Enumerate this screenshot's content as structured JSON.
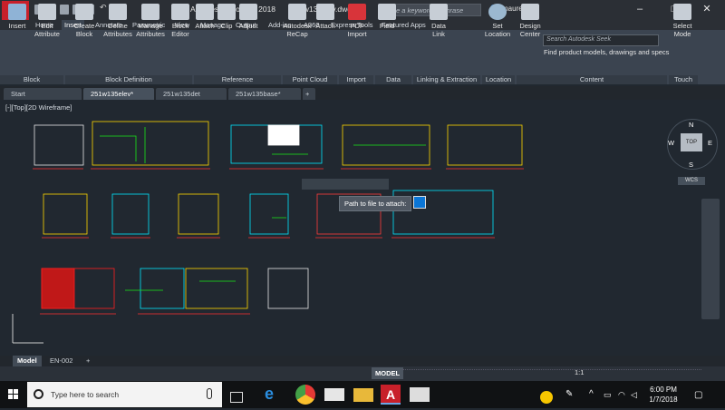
{
  "app": {
    "logo": "A",
    "title": "Autodesk AutoCAD 2018",
    "filename": "251w135elev.dwg",
    "search_placeholder": "Type a keyword or phrase",
    "user": "maureenc",
    "win_min": "–",
    "win_max": "□",
    "win_close": "✕"
  },
  "ribbon_tabs": [
    "Home",
    "Insert",
    "Annotate",
    "Parametric",
    "View",
    "Manage",
    "Output",
    "Add-ins",
    "A360",
    "Express Tools",
    "Featured Apps"
  ],
  "ribbon_buttons": {
    "insert": "Insert",
    "edit_attribute": [
      "Edit",
      "Attribute"
    ],
    "create_block": [
      "Create",
      "Block"
    ],
    "define_attributes": [
      "Define",
      "Attributes"
    ],
    "manage_attributes": [
      "Manage",
      "Attributes"
    ],
    "block_editor": [
      "Block",
      "Editor"
    ],
    "attach": "Attach",
    "clip": "Clip",
    "adjust": "Adjust",
    "recap": [
      "Autodesk",
      "ReCap"
    ],
    "attach2": "Attach",
    "pdf_import": [
      "PDF",
      "Import"
    ],
    "field": "Field",
    "data_link": [
      "Data",
      "Link"
    ],
    "set_location": [
      "Set",
      "Location"
    ],
    "design_center": [
      "Design",
      "Center"
    ],
    "select_mode": [
      "Select",
      "Mode"
    ]
  },
  "ribbon_groups": {
    "block": "Block",
    "block_definition": "Block Definition",
    "reference": "Reference",
    "point_cloud": "Point Cloud",
    "import": "Import",
    "data": "Data",
    "linking": "Linking & Extraction",
    "location": "Location",
    "content": "Content",
    "touch": "Touch"
  },
  "seek": {
    "placeholder": "Search Autodesk Seek",
    "description": "Find product models, drawings and specs"
  },
  "doc_tabs": [
    "Start",
    "251w135elev*",
    "251w135det",
    "251w135base*"
  ],
  "viewport_label": "[-][Top][2D Wireframe]",
  "viewcube": {
    "n": "N",
    "s": "S",
    "e": "E",
    "w": "W",
    "top": "TOP",
    "wcs": "WCS"
  },
  "tooltip": "Path to file to attach:",
  "layout_tabs": [
    "Model",
    "EN-002"
  ],
  "status": {
    "model": "MODEL",
    "scale": "1:1"
  },
  "taskbar": {
    "search": "Type here to search",
    "time": "6:00 PM",
    "date": "1/7/2018"
  }
}
